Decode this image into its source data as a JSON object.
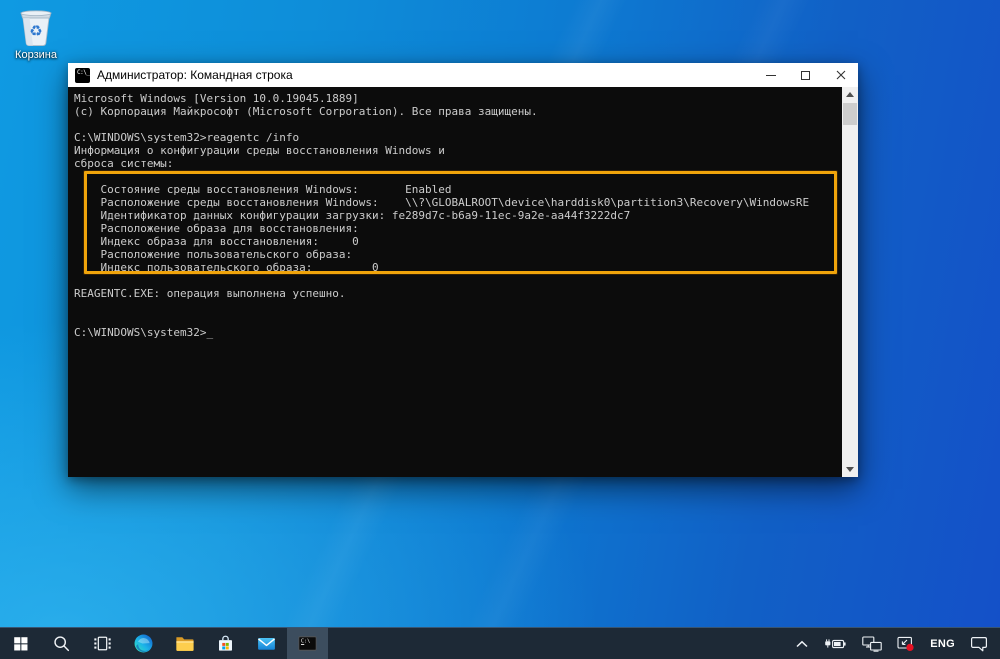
{
  "colors": {
    "highlight_border": "#F0A40B",
    "console_bg": "#0C0C0C",
    "console_fg": "#CCCCCC",
    "titlebar_bg": "#FFFFFF",
    "taskbar_bg": "#1D2936",
    "wallpaper_left": "#0F9AE2",
    "wallpaper_right": "#1450C8",
    "alert_dot": "#E81123"
  },
  "desktop": {
    "recycle_bin_label": "Корзина"
  },
  "window": {
    "title": "Администратор: Командная строка",
    "controls": [
      "minimize",
      "maximize",
      "close"
    ]
  },
  "terminal": {
    "lines": [
      "Microsoft Windows [Version 10.0.19045.1889]",
      "(с) Корпорация Майкрософт (Microsoft Corporation). Все права защищены.",
      "",
      "C:\\WINDOWS\\system32>reagentc /info",
      "Информация о конфигурации среды восстановления Windows и",
      "сброса системы:",
      "",
      "    Состояние среды восстановления Windows:       Enabled",
      "    Расположение среды восстановления Windows:    \\\\?\\GLOBALROOT\\device\\harddisk0\\partition3\\Recovery\\WindowsRE",
      "    Идентификатор данных конфигурации загрузки: fe289d7c-b6a9-11ec-9a2e-aa44f3222dc7",
      "    Расположение образа для восстановления:",
      "    Индекс образа для восстановления:     0",
      "    Расположение пользовательского образа:",
      "    Индекс пользовательского образа:         0",
      "",
      "REAGENTC.EXE: операция выполнена успешно.",
      "",
      "",
      "C:\\WINDOWS\\system32>_"
    ]
  },
  "taskbar": {
    "items": [
      {
        "icon": "start-icon"
      },
      {
        "icon": "search-icon"
      },
      {
        "icon": "task-view-icon"
      },
      {
        "icon": "edge-icon"
      },
      {
        "icon": "file-explorer-icon"
      },
      {
        "icon": "store-icon"
      },
      {
        "icon": "mail-icon"
      },
      {
        "icon": "command-prompt-icon",
        "active": true
      }
    ],
    "tray": {
      "language": "ENG",
      "icons": [
        "chevron-up-icon",
        "battery-icon",
        "network-icon",
        "monitor-alert-icon",
        "action-center-icon"
      ]
    }
  }
}
